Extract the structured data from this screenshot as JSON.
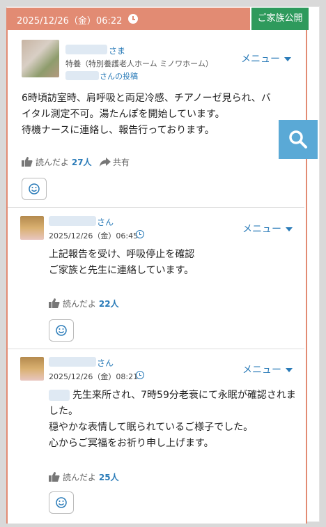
{
  "header": {
    "date_time": "2025/12/26（金）06:22",
    "family_public_label": "ご家族公開"
  },
  "post": {
    "name_suffix": "さま",
    "facility": "特養（特別養護老人ホーム ミノワホーム）",
    "poster_suffix": "さんの投稿",
    "menu_label": "メニュー",
    "body": "6時頃訪室時、肩呼吸と両足冷感、チアノーゼ見られ、バイタル測定不可。湯たんぽを開始しています。\n待機ナースに連絡し、報告行っております。",
    "reads_label": "読んだよ",
    "reads_count": "27人",
    "share_label": "共有"
  },
  "comments": [
    {
      "name_suffix": "さん",
      "time": "2025/12/26（金）06:45",
      "menu_label": "メニュー",
      "body": "上記報告を受け、呼吸停止を確認\nご家族と先生に連絡しています。",
      "reads_label": "読んだよ",
      "reads_count": "22人"
    },
    {
      "name_suffix": "さん",
      "time": "2025/12/26（金）08:21",
      "menu_label": "メニュー",
      "body": "先生来所され、7時59分老衰にて永眠が確認されました。\n穏やかな表情して眠られているご様子でした。\n心からご冥福をお祈り申し上げます。",
      "reads_label": "読んだよ",
      "reads_count": "25人"
    }
  ],
  "colors": {
    "header_bg": "#e28b73",
    "family_badge": "#2e9a5c",
    "link_blue": "#2a7bb8",
    "search_bg": "#5aa9d6"
  },
  "icons": [
    "clock-icon",
    "caret-down-icon",
    "thumbs-up-icon",
    "share-arrow-icon",
    "smiley-icon",
    "search-icon"
  ]
}
